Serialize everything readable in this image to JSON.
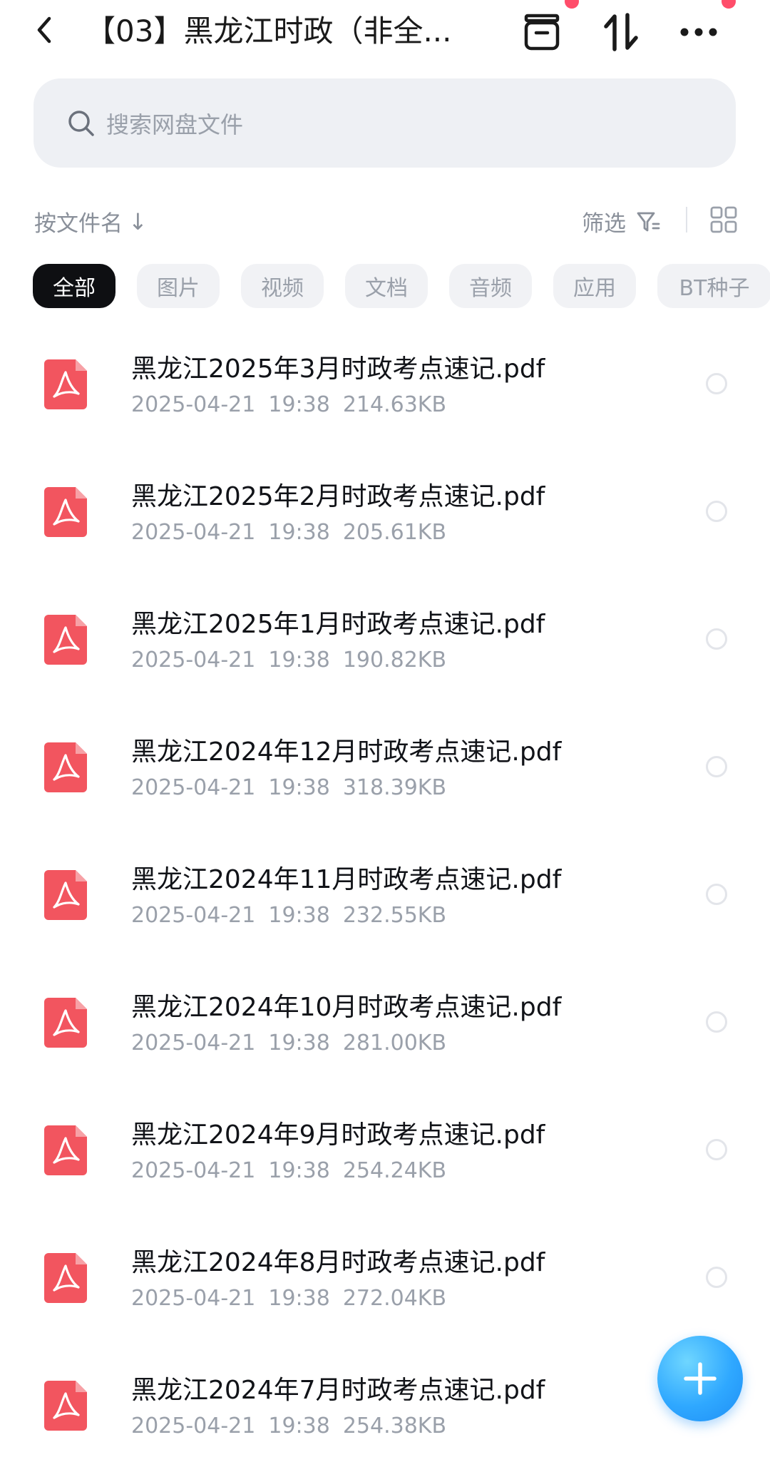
{
  "header": {
    "title": "【03】黑龙江时政（非全...",
    "back_icon": "chevron-left-icon",
    "archive_icon": "archive-box-icon",
    "sort_icon": "sort-transfer-icon",
    "more_icon": "more-dots-icon",
    "notification_color": "#ff4d6a"
  },
  "search": {
    "placeholder": "搜索网盘文件",
    "icon": "search-icon"
  },
  "sort": {
    "label": "按文件名",
    "arrow": "↓",
    "filter_label": "筛选",
    "filter_icon": "filter-icon",
    "view_icon": "grid-view-icon"
  },
  "categories": [
    {
      "label": "全部",
      "active": true
    },
    {
      "label": "图片",
      "active": false
    },
    {
      "label": "视频",
      "active": false
    },
    {
      "label": "文档",
      "active": false
    },
    {
      "label": "音频",
      "active": false
    },
    {
      "label": "应用",
      "active": false
    },
    {
      "label": "BT种子",
      "active": false
    }
  ],
  "files": [
    {
      "name": "黑龙江2025年3月时政考点速记.pdf",
      "date": "2025-04-21",
      "time": "19:38",
      "size": "214.63KB"
    },
    {
      "name": "黑龙江2025年2月时政考点速记.pdf",
      "date": "2025-04-21",
      "time": "19:38",
      "size": "205.61KB"
    },
    {
      "name": "黑龙江2025年1月时政考点速记.pdf",
      "date": "2025-04-21",
      "time": "19:38",
      "size": "190.82KB"
    },
    {
      "name": "黑龙江2024年12月时政考点速记.pdf",
      "date": "2025-04-21",
      "time": "19:38",
      "size": "318.39KB"
    },
    {
      "name": "黑龙江2024年11月时政考点速记.pdf",
      "date": "2025-04-21",
      "time": "19:38",
      "size": "232.55KB"
    },
    {
      "name": "黑龙江2024年10月时政考点速记.pdf",
      "date": "2025-04-21",
      "time": "19:38",
      "size": "281.00KB"
    },
    {
      "name": "黑龙江2024年9月时政考点速记.pdf",
      "date": "2025-04-21",
      "time": "19:38",
      "size": "254.24KB"
    },
    {
      "name": "黑龙江2024年8月时政考点速记.pdf",
      "date": "2025-04-21",
      "time": "19:38",
      "size": "272.04KB"
    },
    {
      "name": "黑龙江2024年7月时政考点速记.pdf",
      "date": "2025-04-21",
      "time": "19:38",
      "size": "254.38KB"
    }
  ],
  "fab": {
    "icon": "plus-icon"
  },
  "colors": {
    "accent": "#2fa8ff",
    "pdf_red": "#f2555f",
    "active_chip": "#0e0f12"
  }
}
